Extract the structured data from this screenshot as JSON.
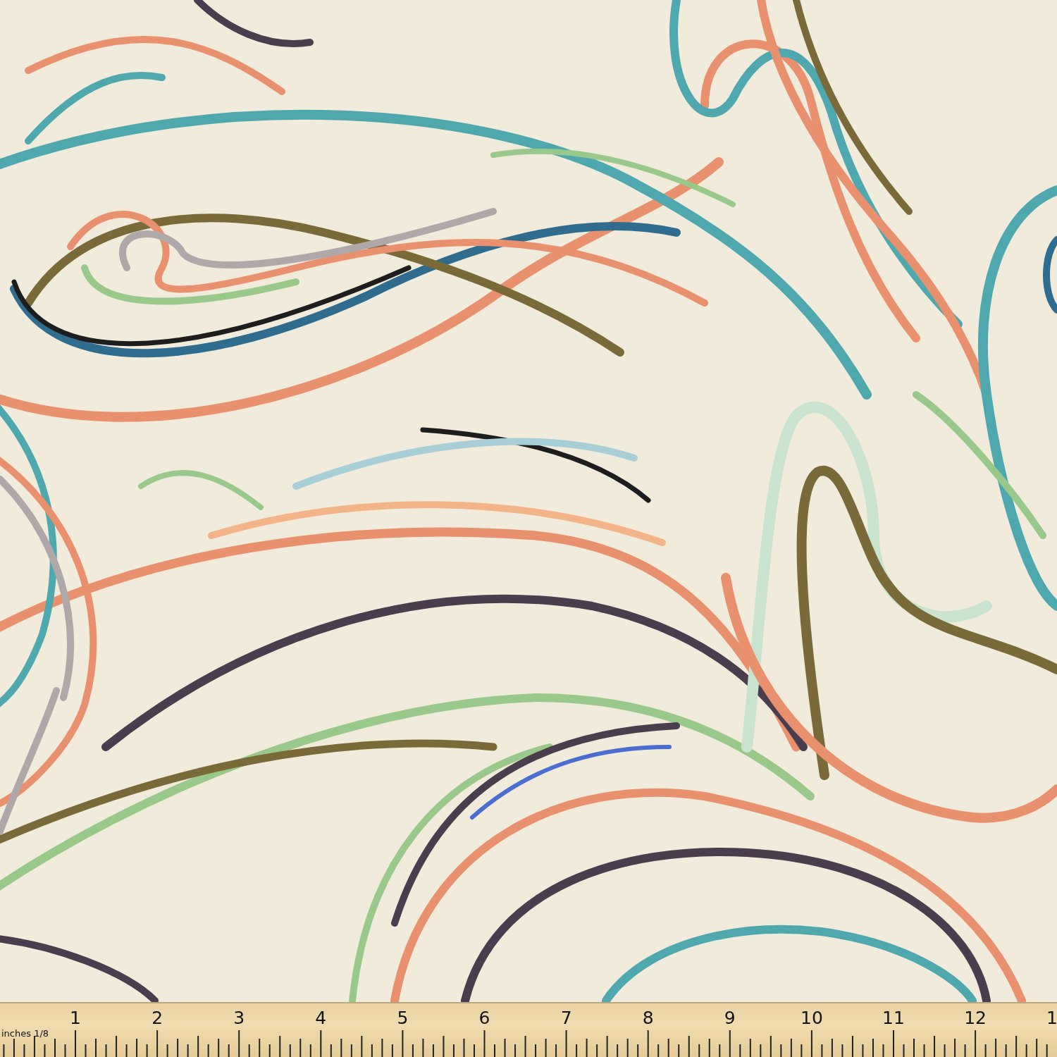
{
  "fabric": {
    "kind": "swirl-print"
  },
  "ruler": {
    "unit_label": "inches 1/8",
    "numbers": [
      "1",
      "2",
      "3",
      "4",
      "5",
      "6",
      "7",
      "8",
      "9",
      "10",
      "11",
      "12",
      "1"
    ]
  }
}
